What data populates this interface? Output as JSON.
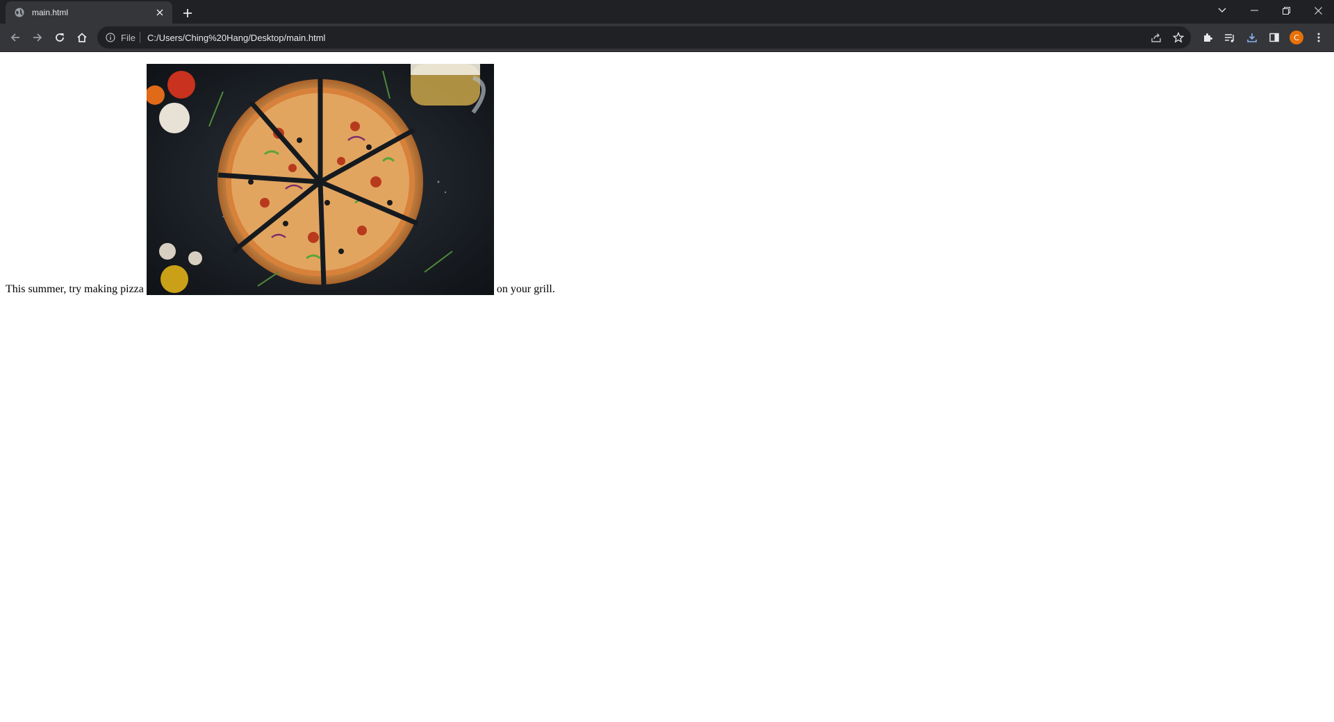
{
  "browser": {
    "tab": {
      "title": "main.html",
      "favicon": "globe-icon"
    },
    "omnibox": {
      "scheme_label": "File",
      "url": "C:/Users/Ching%20Hang/Desktop/main.html"
    },
    "profile_initial": "C",
    "colors": {
      "tabstrip": "#202124",
      "toolbar": "#35363a",
      "omnibox": "#202124",
      "profile": "#e8710a"
    }
  },
  "page": {
    "text_before": "This summer, try making pizza",
    "image_alt": "pizza",
    "text_after": "on your grill."
  }
}
